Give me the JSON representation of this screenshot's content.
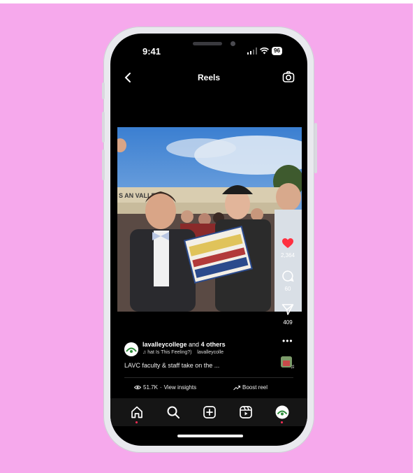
{
  "status": {
    "time": "9:41",
    "battery": "96"
  },
  "header": {
    "title": "Reels"
  },
  "video": {
    "sign_text": "S AN   VALLEY"
  },
  "actions": {
    "likes": "2,364",
    "comments": "60",
    "shares": "409"
  },
  "caption": {
    "username": "lavalleycollege",
    "connector": " and ",
    "others": "4 others",
    "audio_song": "hat Is This Feeling?)",
    "audio_artist": "lavalleycolle",
    "text": "LAVC faculty & staff take on the ...",
    "more": "•••"
  },
  "insights": {
    "views": "51.7K",
    "separator": " · ",
    "label": "View insights",
    "boost": "Boost reel"
  },
  "colors": {
    "background": "#f6a9ec",
    "heart": "#ff3040",
    "screen": "#000000"
  },
  "icons": [
    "back-icon",
    "camera-icon",
    "heart-icon",
    "comment-icon",
    "share-icon",
    "home-icon",
    "search-icon",
    "create-icon",
    "reels-icon",
    "profile-avatar"
  ]
}
